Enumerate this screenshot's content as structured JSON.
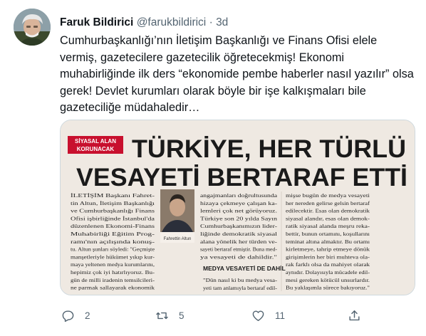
{
  "tweet": {
    "author_name": "Faruk Bildirici",
    "handle": "@farukbildirici",
    "separator": "·",
    "time": "3d",
    "text": "Cumhurbaşkanlığı’nın İletişim Başkanlığı ve Finans Ofisi elele vermiş, gazetecilere gazetecilik öğretecekmiş! Ekonomi muhabirliğinde ilk ders “ekonomide pembe haberler nasıl yazılır” olsa gerek! Devlet kurumları olarak böyle bir işe kalkışmaları bile gazeteciliğe müdahaledir…"
  },
  "clipping": {
    "tag_line1": "SİYASAL ALAN",
    "tag_line2": "KORUNACAK",
    "headline1": "TÜRKİYE, HER TÜRLÜ",
    "headline2": "VESAYETİ BERTARAF ETTİ",
    "photo_caption": "Fahrettin Altun",
    "subheading": "MEDYA VESAYETİ DE DAHİL",
    "col1": [
      "İLETİŞİM Başkanı Fahret-",
      "tin Altun, İletişim Başkanlığı",
      "ve Cumhurbaşkanlığı Finans",
      "Ofisi işbirliğinde İstanbul'da",
      "düzenlenen Ekonomi-Finans",
      "Muhabirliği Eğitim Prog-",
      "ramı'nın açılışında konuş-",
      "tu. Altun şunları söyledi: \"Geçmişte",
      "manşetleriyle hükümet yıkıp kur-",
      "maya yeltenen medya kurumlarını,",
      "hepimiz çok iyi hatırlıyoruz. Bu-",
      "gün de milli iradenin temsilcileri-",
      "ne parmak sallayarak ekonomik"
    ],
    "col2": [
      "angajmanları doğrultusunda",
      "hizaya çekmeye çalışan ka-",
      "lemleri çok net görüyoruz.",
      "Türkiye son 20 yılda Sayın",
      "Cumhurbaşkanımızın lider-",
      "liğinde demokratik siyasal",
      "alana yönelik her türden ve-",
      "sayeti bertaraf etmiştir. Buna med-",
      "ya vesayeti de dahildir.\""
    ],
    "col2_after": [
      "\"Dün nasıl ki bu medya vesa-",
      "yeti tam anlamıyla bertaraf edil-"
    ],
    "col3": [
      "mişse bugün de medya vesayeti",
      "her nereden gelirse gelsin bertaraf",
      "edilecektir. Esas olan demokratik",
      "siyasal alandır, esas olan demok-",
      "ratik siyasal alanda meşru reka-",
      "bettir, bunun ortamını, koşullarını",
      "teminat altına almaktır. Bu ortamı",
      "kirletmeye, tahrip etmeye dönük",
      "girişimlerin her biri muhteva ola-",
      "rak farklı olsa da mahiyet olarak",
      "aynıdır. Dolayısıyla mücadele edil-",
      "mesi gereken kötücül unsurlardır.",
      "Bu yaklaşımla sürece bakıyoruz.\""
    ]
  },
  "actions": {
    "reply_count": "2",
    "retweet_count": "5",
    "like_count": "11"
  },
  "colors": {
    "tag_red": "#c8102e",
    "headline": "#1a1a1a",
    "icon_gray": "#536471"
  }
}
